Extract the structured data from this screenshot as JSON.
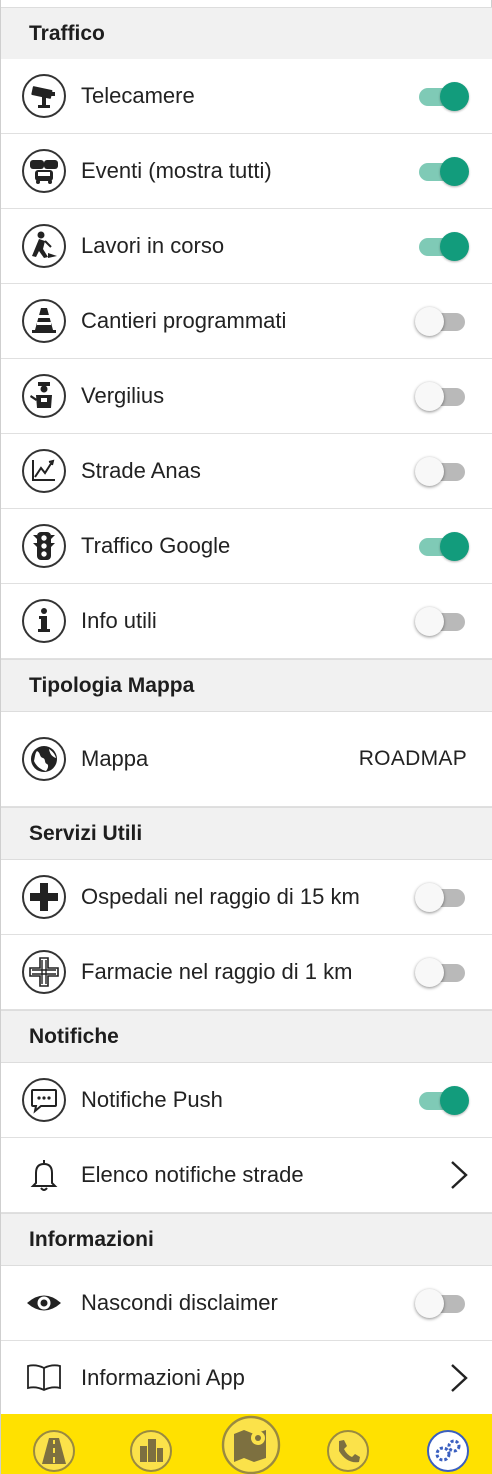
{
  "colors": {
    "accent": "#129c7c",
    "track_on": "#7fcab6",
    "bar": "#ffe100"
  },
  "sections": {
    "traffico": "Traffico",
    "tipologia": "Tipologia Mappa",
    "servizi": "Servizi Utili",
    "notifiche": "Notifiche",
    "informazioni": "Informazioni"
  },
  "traffico": [
    {
      "icon": "speed-camera-icon",
      "label": "Telecamere",
      "on": true
    },
    {
      "icon": "cars-icon",
      "label": "Eventi (mostra tutti)",
      "on": true
    },
    {
      "icon": "roadworks-icon",
      "label": "Lavori in corso",
      "on": true
    },
    {
      "icon": "traffic-cone-icon",
      "label": "Cantieri programmati",
      "on": false
    },
    {
      "icon": "police-officer-icon",
      "label": "Vergilius",
      "on": false
    },
    {
      "icon": "chart-icon",
      "label": "Strade Anas",
      "on": false
    },
    {
      "icon": "traffic-light-icon",
      "label": "Traffico Google",
      "on": true
    },
    {
      "icon": "info-icon",
      "label": "Info utili",
      "on": false
    }
  ],
  "mappa": {
    "label": "Mappa",
    "value": "ROADMAP"
  },
  "servizi": [
    {
      "icon": "hospital-cross-icon",
      "label": "Ospedali nel raggio di 15 km",
      "on": false
    },
    {
      "icon": "pharmacy-cross-icon",
      "label": "Farmacie nel raggio di 1 km",
      "on": false
    }
  ],
  "notifiche": {
    "push": {
      "label": "Notifiche Push",
      "on": true
    },
    "elenco": {
      "label": "Elenco notifiche strade"
    }
  },
  "informazioni": {
    "disclaimer": {
      "label": "Nascondi disclaimer",
      "on": false
    },
    "app": {
      "label": "Informazioni App"
    }
  },
  "bottom_nav": [
    "road-icon",
    "city-icon",
    "map-icon",
    "phone-icon",
    "settings-gears-icon"
  ]
}
